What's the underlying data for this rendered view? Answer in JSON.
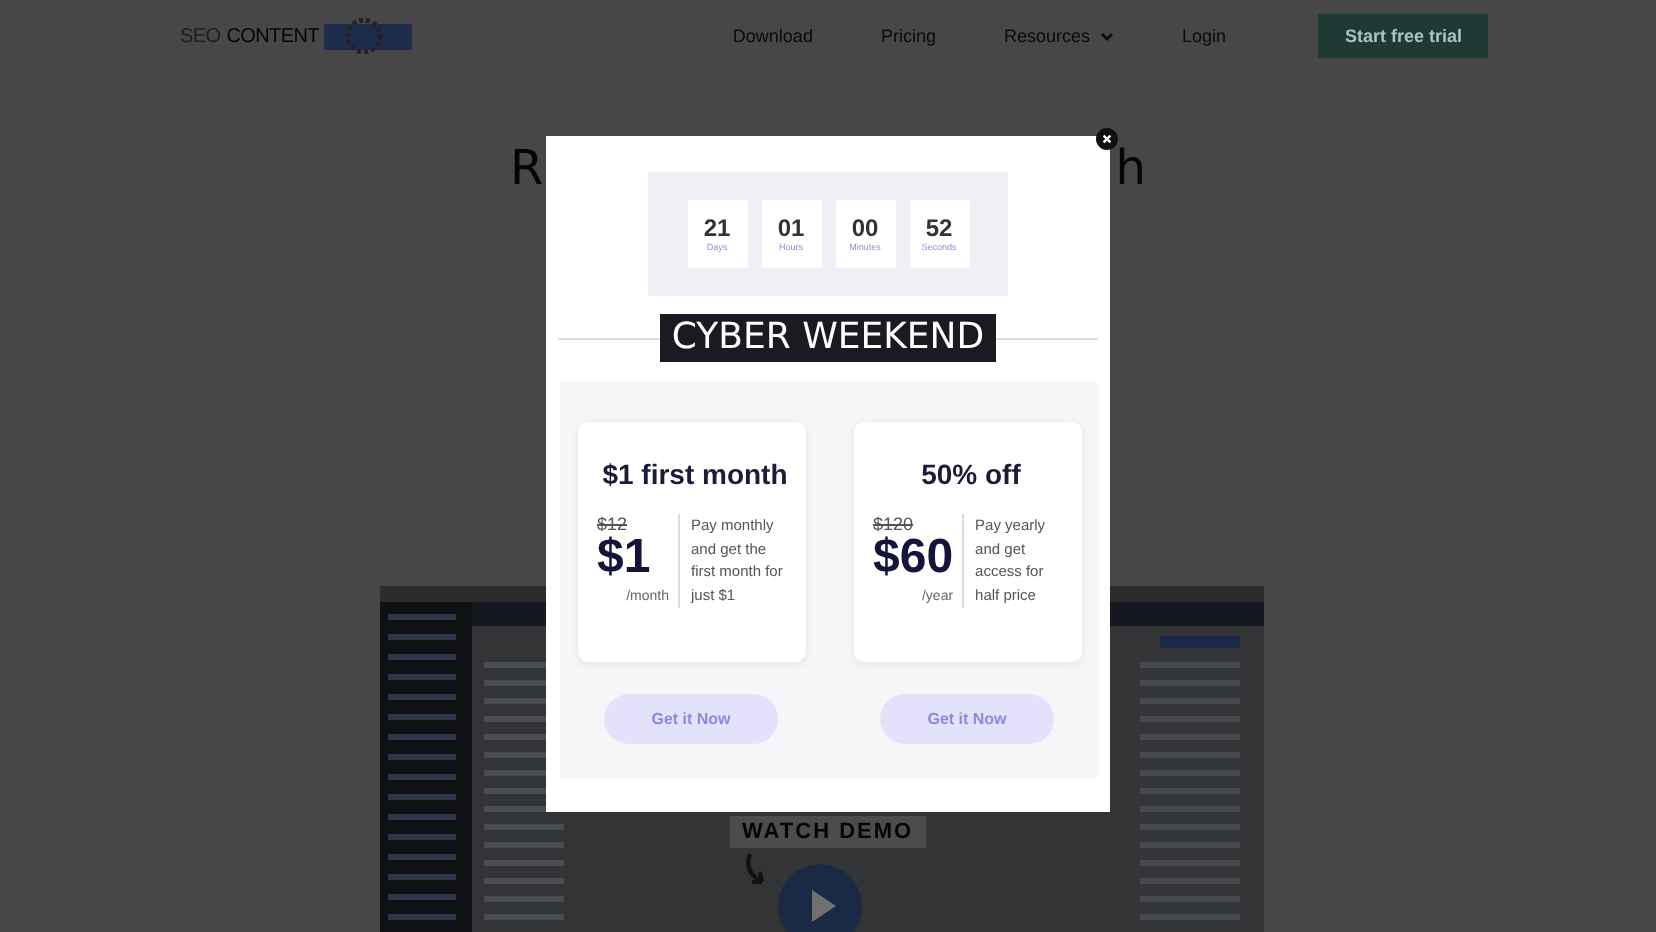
{
  "nav": {
    "logo_words": [
      "SEO",
      "CONTENT"
    ],
    "links": [
      {
        "label": "Download",
        "kind": "link"
      },
      {
        "label": "Pricing",
        "kind": "link"
      },
      {
        "label": "Resources",
        "kind": "dropdown"
      },
      {
        "label": "Login",
        "kind": "link"
      }
    ],
    "cta": "Start free trial"
  },
  "hero": {
    "heading_fragments": [
      "R",
      "h"
    ]
  },
  "demo": {
    "label": "WATCH DEMO"
  },
  "popup": {
    "countdown": [
      {
        "value": "21",
        "unit": "Days"
      },
      {
        "value": "01",
        "unit": "Hours"
      },
      {
        "value": "00",
        "unit": "Minutes"
      },
      {
        "value": "52",
        "unit": "Seconds"
      }
    ],
    "banner": "CYBER WEEKEND",
    "offers": [
      {
        "title": "$1 first month",
        "old_price": "$12",
        "price": "$1",
        "period": "/month",
        "description": "Pay monthly and get the first month for just $1",
        "button": "Get it Now"
      },
      {
        "title": "50% off",
        "old_price": "$120",
        "price": "$60",
        "period": "/year",
        "description": "Pay yearly and get access for half price",
        "button": "Get it Now"
      }
    ]
  }
}
